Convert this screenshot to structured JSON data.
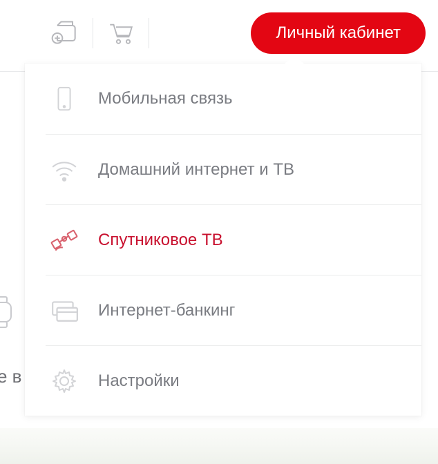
{
  "colors": {
    "accent": "#e30613",
    "accent_text": "#c8102e",
    "muted": "#7a7c82",
    "icon": "#d2d3d6"
  },
  "toolbar": {
    "wallet_icon": "wallet-add-icon",
    "cart_icon": "cart-icon",
    "account_button_label": "Личный кабинет"
  },
  "menu": {
    "items": [
      {
        "icon": "phone-icon",
        "label": "Мобильная связь",
        "active": false
      },
      {
        "icon": "wifi-icon",
        "label": "Домашний интернет и ТВ",
        "active": false
      },
      {
        "icon": "satellite-icon",
        "label": "Спутниковое ТВ",
        "active": true
      },
      {
        "icon": "card-icon",
        "label": "Интернет-банкинг",
        "active": false
      },
      {
        "icon": "gear-icon",
        "label": "Настройки",
        "active": false
      }
    ]
  },
  "background": {
    "fragment_text": "е в"
  }
}
